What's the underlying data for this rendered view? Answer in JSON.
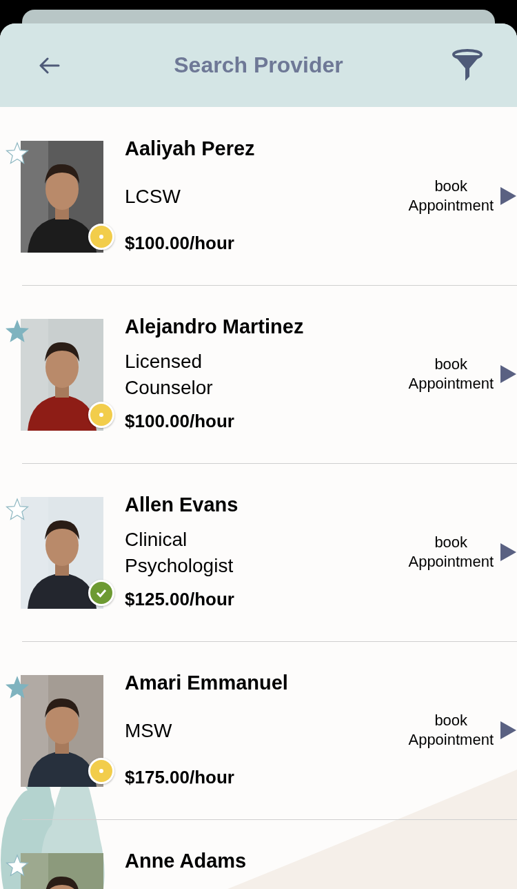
{
  "header": {
    "title": "Search Provider"
  },
  "providers": [
    {
      "name": "Aaliyah Perez",
      "credential": "LCSW",
      "rate": "$100.00/hour",
      "favorite": false,
      "status": {
        "kind": "dot",
        "color": "#f2cd4b"
      },
      "book": [
        "book",
        "Appointment"
      ]
    },
    {
      "name": "Alejandro Martinez",
      "credential": "Licensed Counselor",
      "rate": "$100.00/hour",
      "favorite": true,
      "status": {
        "kind": "dot",
        "color": "#f2cd4b"
      },
      "book": [
        "book",
        "Appointment"
      ]
    },
    {
      "name": "Allen Evans",
      "credential": "Clinical Psychologist",
      "rate": "$125.00/hour",
      "favorite": false,
      "status": {
        "kind": "check",
        "color": "#6d9a32"
      },
      "book": [
        "book",
        "Appointment"
      ]
    },
    {
      "name": "Amari Emmanuel",
      "credential": "MSW",
      "rate": "$175.00/hour",
      "favorite": true,
      "status": {
        "kind": "dot",
        "color": "#f2cd4b"
      },
      "book": [
        "book",
        "Appointment"
      ]
    },
    {
      "name": "Anne Adams",
      "favorite": false
    }
  ]
}
